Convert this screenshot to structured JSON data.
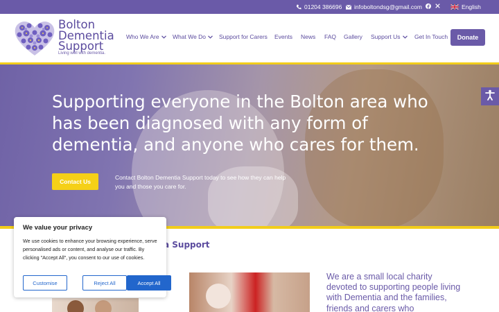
{
  "topbar": {
    "phone": "01204 386696",
    "email": "infoboltondsg@gmail.com",
    "language": "English"
  },
  "logo": {
    "line1": "Bolton",
    "line2": "Dementia",
    "line3": "Support",
    "tagline": "Living well with dementia."
  },
  "nav": {
    "items": [
      {
        "label": "Who We Are"
      },
      {
        "label": "What We Do"
      },
      {
        "label": "Support for Carers"
      },
      {
        "label": "Events"
      },
      {
        "label": "News"
      },
      {
        "label": "FAQ"
      },
      {
        "label": "Gallery"
      },
      {
        "label": "Support Us"
      },
      {
        "label": "Get In Touch"
      }
    ],
    "donate": "Donate"
  },
  "hero": {
    "title": "Supporting everyone in the Bolton area who has been diagnosed with any form of dementia, and anyone who cares for them.",
    "button": "Contact Us",
    "subtitle": "Contact Bolton Dementia Support today to see how they can help you and those you care for."
  },
  "main": {
    "section_title_visible": "a Support",
    "intro": "We are a small local charity devoted to supporting people living with Dementia and the families, friends and carers who"
  },
  "cookie": {
    "title": "We value your privacy",
    "body": "We use cookies to enhance your browsing experience, serve personalised ads or content, and analyse our traffic. By clicking \"Accept All\", you consent to our use of cookies.",
    "customise": "Customise",
    "reject": "Reject All",
    "accept": "Accept All"
  },
  "colors": {
    "brand_purple": "#6a5aa8",
    "accent_yellow": "#f2cd1a",
    "cookie_blue": "#2266cc"
  }
}
